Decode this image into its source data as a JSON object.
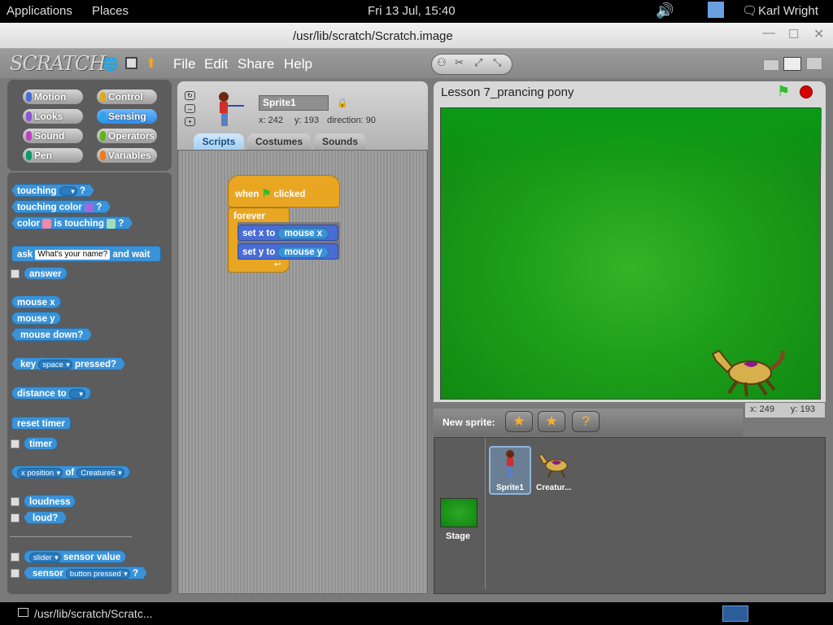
{
  "topbar": {
    "applications": "Applications",
    "places": "Places",
    "clock": "Fri 13 Jul, 15:40",
    "user": "Karl Wright"
  },
  "window": {
    "title": "/usr/lib/scratch/Scratch.image"
  },
  "menubar": {
    "logo": "SCRATCH",
    "file": "File",
    "edit": "Edit",
    "share": "Share",
    "help": "Help"
  },
  "categories": [
    {
      "label": "Motion",
      "color": "#4a6cd4"
    },
    {
      "label": "Control",
      "color": "#e1a91a"
    },
    {
      "label": "Looks",
      "color": "#8a55d7"
    },
    {
      "label": "Sensing",
      "color": "#2ca5e2"
    },
    {
      "label": "Sound",
      "color": "#bb42c3"
    },
    {
      "label": "Operators",
      "color": "#5cb712"
    },
    {
      "label": "Pen",
      "color": "#0e9a6c"
    },
    {
      "label": "Variables",
      "color": "#ee7d16"
    }
  ],
  "palette": {
    "touching": "touching",
    "q": "?",
    "touching_color": "touching color",
    "color": "color",
    "is_touching": "is touching",
    "ask": "ask",
    "ask_default": "What's your name?",
    "and_wait": "and wait",
    "answer": "answer",
    "mouse_x": "mouse x",
    "mouse_y": "mouse y",
    "mouse_down": "mouse down?",
    "key": "key",
    "key_space": "space",
    "pressed": "pressed?",
    "distance_to": "distance to",
    "reset_timer": "reset timer",
    "timer": "timer",
    "x_position": "x position",
    "of": "of",
    "creature": "Creature6",
    "loudness": "loudness",
    "loud": "loud?",
    "slider": "slider",
    "sensor_value": "sensor value",
    "sensor": "sensor",
    "button_pressed": "button pressed"
  },
  "sprite": {
    "name": "Sprite1",
    "x": "x: 242",
    "y": "y: 193",
    "direction": "direction: 90"
  },
  "tabs": {
    "scripts": "Scripts",
    "costumes": "Costumes",
    "sounds": "Sounds"
  },
  "script": {
    "when": "when",
    "clicked": "clicked",
    "forever": "forever",
    "set_x": "set x to",
    "set_y": "set y to",
    "mouse_x": "mouse x",
    "mouse_y": "mouse y"
  },
  "stage": {
    "title": "Lesson 7_prancing pony",
    "coords_x": "x: 249",
    "coords_y": "y: 193"
  },
  "sprites_pane": {
    "new_sprite": "New sprite:",
    "stage_label": "Stage",
    "sprite1": "Sprite1",
    "creature": "Creatur..."
  },
  "taskbar": {
    "task": "/usr/lib/scratch/Scratc..."
  }
}
